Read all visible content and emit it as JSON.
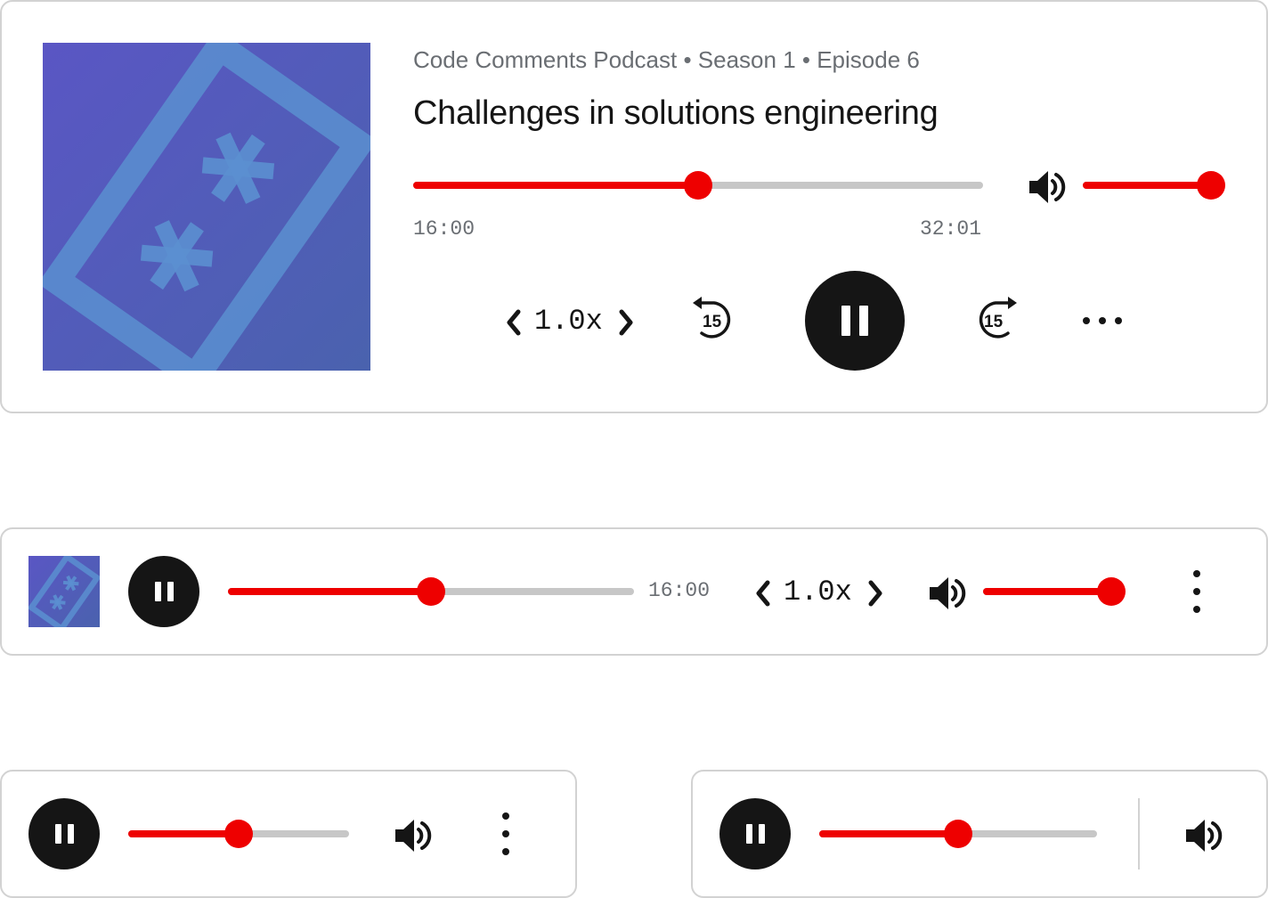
{
  "colors": {
    "accent": "#ee0000",
    "track": "#c7c7c7",
    "control": "#151515",
    "border": "#d2d2d2",
    "art_background": "#5558c0"
  },
  "episode": {
    "meta": "Code Comments Podcast • Season 1 • Episode 6",
    "title": "Challenges in solutions engineering",
    "artwork_icon": "code-comments-asterisk-artwork"
  },
  "players": {
    "full": {
      "progress": 0.5,
      "volume": 1.0,
      "current_time": "16:00",
      "duration": "32:01",
      "speed": "1.0x",
      "rewind_seconds": "15",
      "forward_seconds": "15",
      "icons": [
        "chevron-left-icon",
        "chevron-right-icon",
        "rewind-15-icon",
        "pause-icon",
        "forward-15-icon",
        "more-horizontal-icon",
        "volume-icon"
      ]
    },
    "compact": {
      "progress": 0.5,
      "volume": 1.0,
      "current_time": "16:00",
      "speed": "1.0x",
      "icons": [
        "pause-icon",
        "chevron-left-icon",
        "chevron-right-icon",
        "volume-icon",
        "more-vertical-icon"
      ]
    },
    "mini": {
      "progress": 0.5,
      "icons": [
        "pause-icon",
        "volume-icon",
        "more-vertical-icon"
      ]
    },
    "mini_alt": {
      "progress": 0.5,
      "icons": [
        "pause-icon",
        "volume-icon"
      ]
    }
  }
}
